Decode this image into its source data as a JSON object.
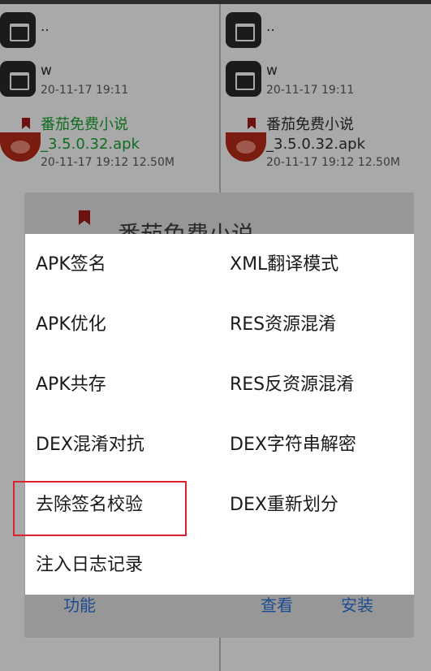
{
  "left_pane": {
    "parent_dir": {
      "name": ".."
    },
    "folder_w": {
      "name": "w",
      "meta": "20-11-17 19:11"
    },
    "apk": {
      "name_line1": "番茄免费小说",
      "name_line2": "_3.5.0.32.apk",
      "meta": "20-11-17 19:12  12.50M"
    }
  },
  "right_pane": {
    "parent_dir": {
      "name": ".."
    },
    "folder_w": {
      "name": "w",
      "meta": "20-11-17 19:11"
    },
    "apk": {
      "name_line1": "番茄免费小说",
      "name_line2": "_3.5.0.32.apk",
      "meta": "20-11-17 19:12  12.50M"
    }
  },
  "background_dialog": {
    "title": "番茄免费小说",
    "buttons": {
      "function": "功能",
      "view": "查看",
      "install": "安装"
    }
  },
  "menu": {
    "left": [
      "APK签名",
      "APK优化",
      "APK共存",
      "DEX混淆对抗",
      "去除签名校验",
      "注入日志记录"
    ],
    "right": [
      "XML翻译模式",
      "RES资源混淆",
      "RES反资源混淆",
      "DEX字符串解密",
      "DEX重新划分"
    ]
  },
  "colors": {
    "highlight": "#d9232f",
    "apk_name_green": "#0e6d1f",
    "dialog_button": "#1c4c8f"
  }
}
